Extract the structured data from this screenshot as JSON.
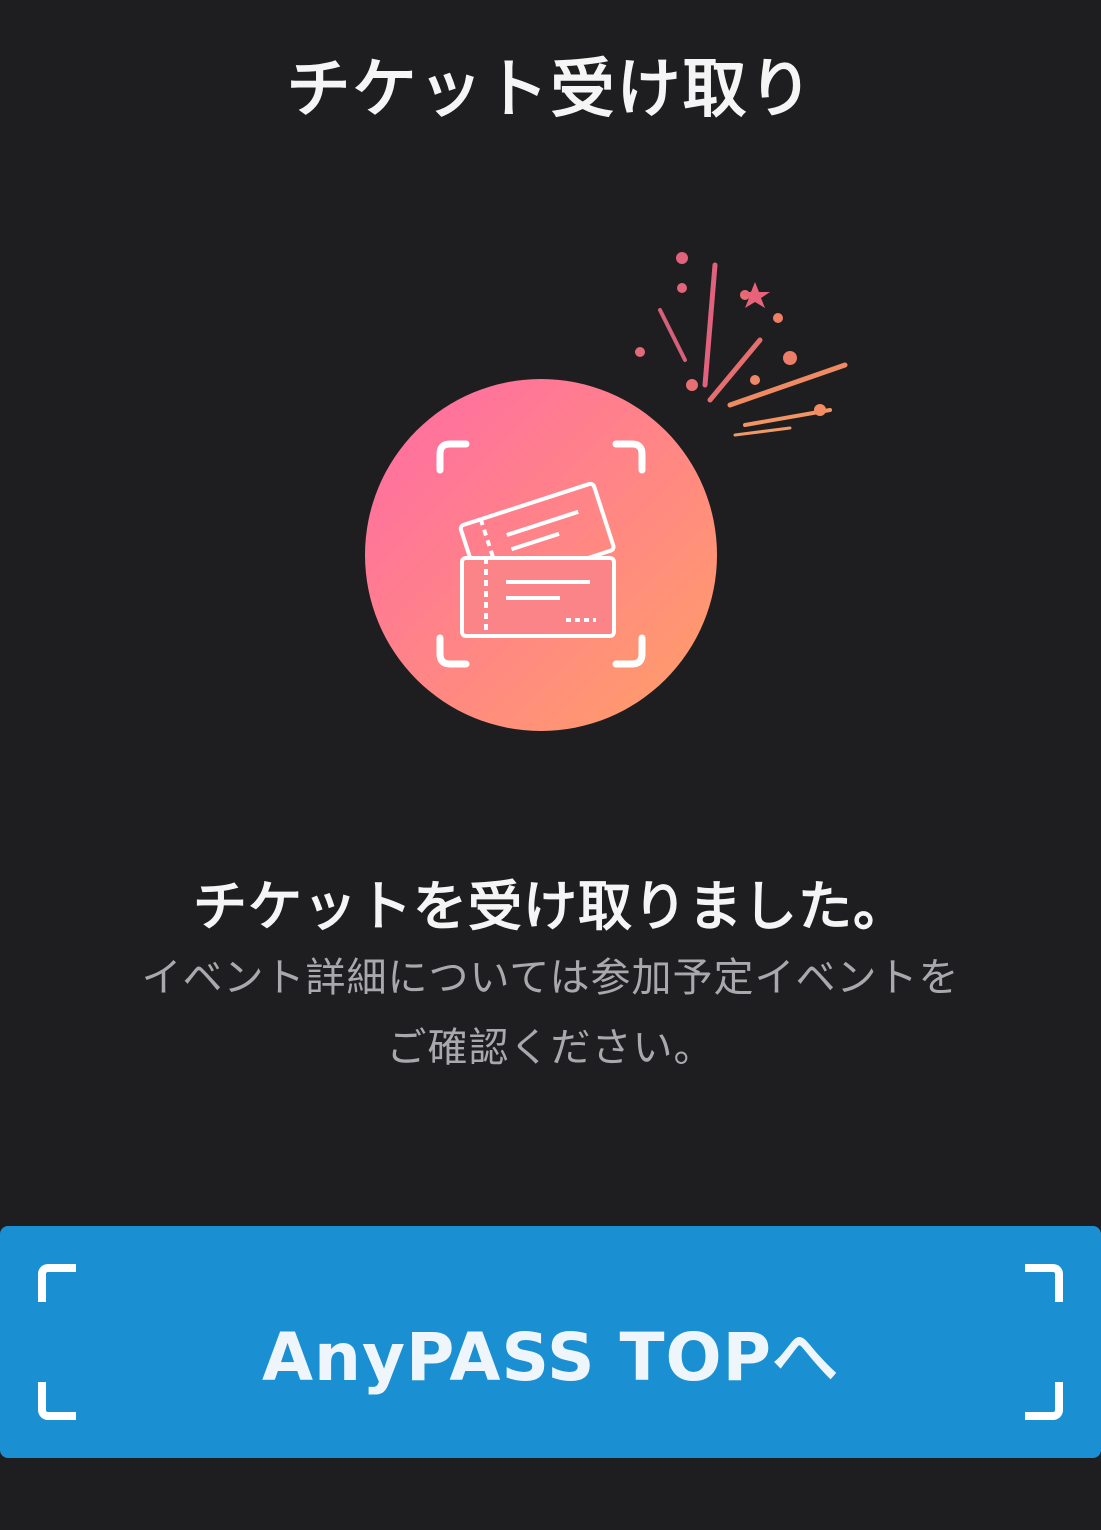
{
  "header": {
    "title": "チケット受け取り"
  },
  "hero": {
    "icon": "ticket-icon",
    "decoration": "confetti-icon",
    "gradient_start": "#ff6fa3",
    "gradient_end": "#ff9a6b"
  },
  "message": {
    "headline": "チケットを受け取りました。",
    "detail_line1": "イベント詳細については参加予定イベントを",
    "detail_line2": "ご確認ください。"
  },
  "cta": {
    "label": "AnyPASS TOPへ",
    "color": "#1a8fd1"
  }
}
